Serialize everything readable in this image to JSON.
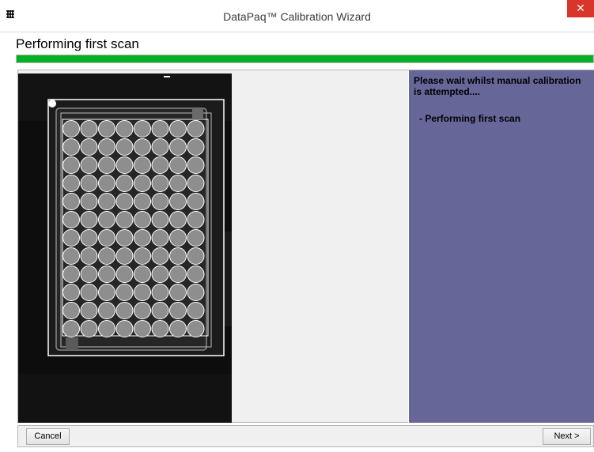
{
  "window": {
    "title": "DataPaq™ Calibration Wizard",
    "app_icon": "app-logo-icon",
    "close_icon": "close-icon",
    "close_symbol": "✕"
  },
  "page": {
    "heading": "Performing first scan"
  },
  "progress": {
    "fraction": 1.0,
    "color": "#06b025"
  },
  "scan": {
    "plate": {
      "rows": 12,
      "cols": 8
    }
  },
  "info": {
    "message": "Please wait whilst manual calibration is attempted....",
    "step": " - Performing first scan",
    "panel_color": "#666699"
  },
  "buttons": {
    "cancel": "Cancel",
    "next": "Next >"
  }
}
